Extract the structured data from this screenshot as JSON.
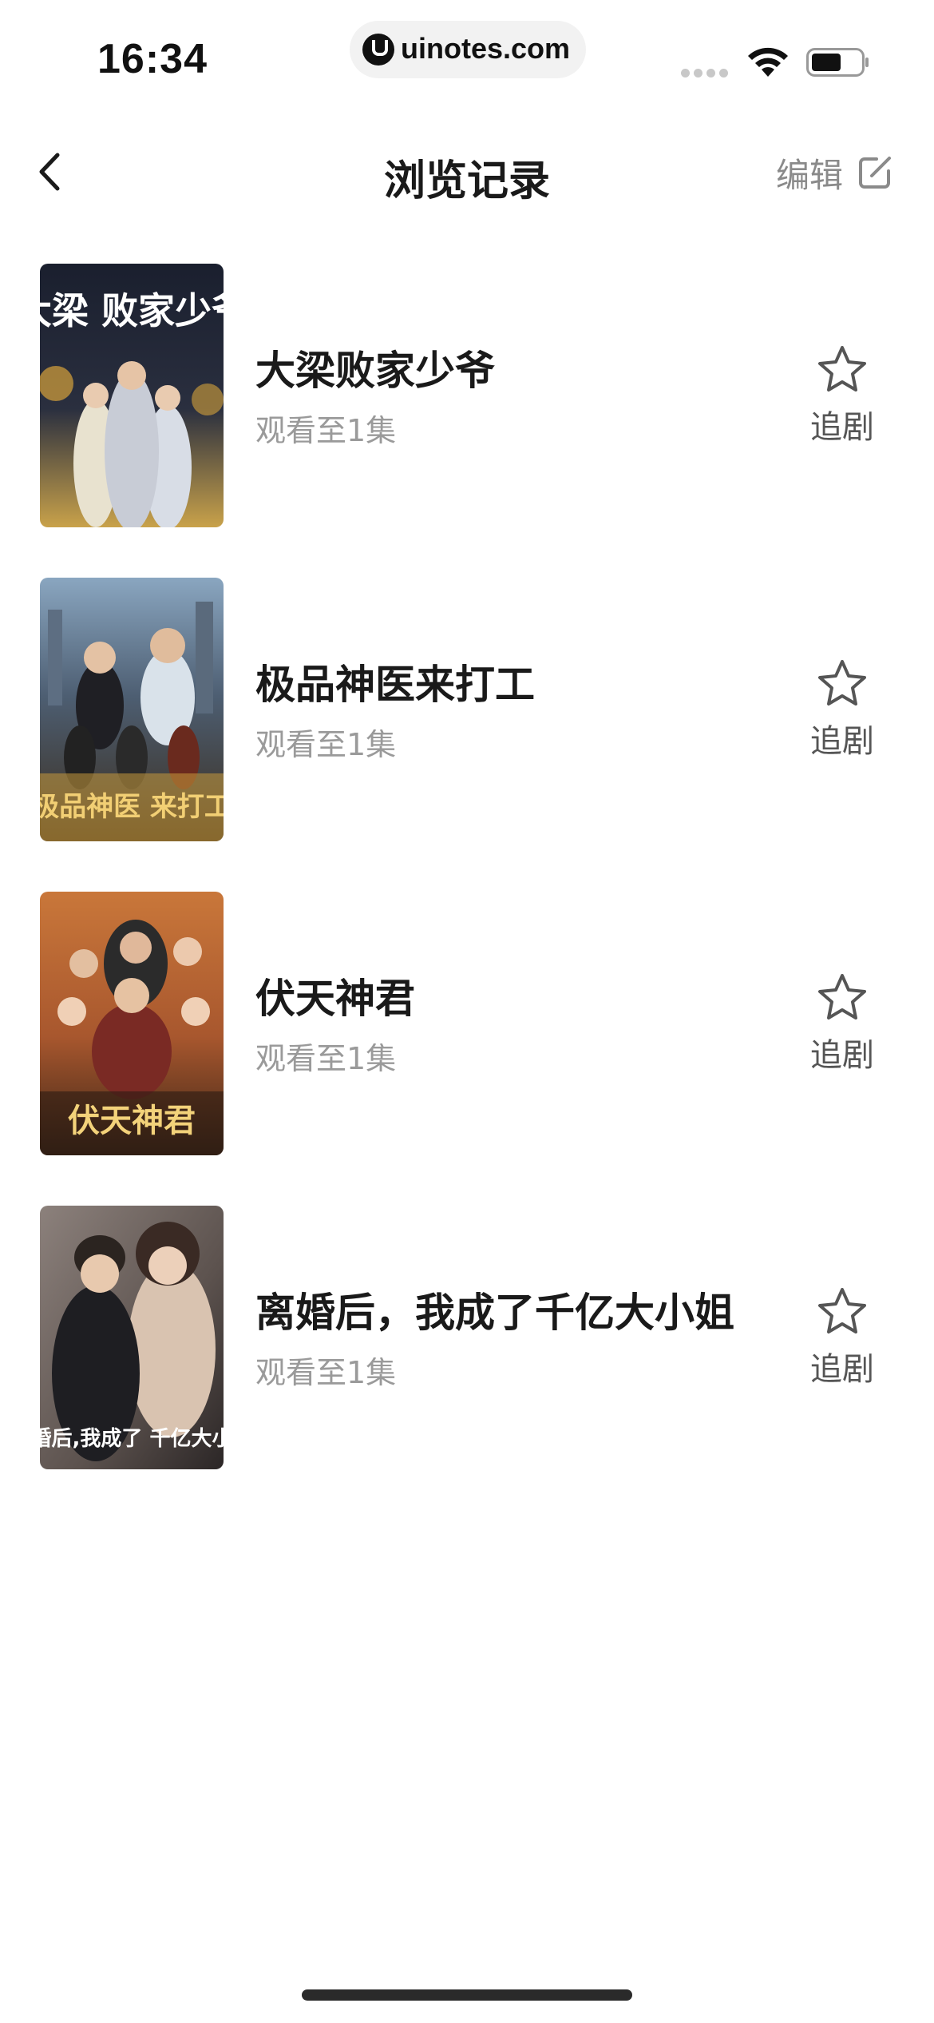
{
  "status_bar": {
    "time": "16:34",
    "url": "uinotes.com"
  },
  "nav": {
    "title": "浏览记录",
    "edit_label": "编辑"
  },
  "history": [
    {
      "title": "大梁败家少爷",
      "progress": "观看至1集",
      "follow_label": "追剧",
      "poster_caption": "大梁 败家少爷",
      "poster_colors": [
        "#1d2233",
        "#b8953f"
      ]
    },
    {
      "title": "极品神医来打工",
      "progress": "观看至1集",
      "follow_label": "追剧",
      "poster_caption": "极品神医 来打工",
      "poster_colors": [
        "#5f7a96",
        "#c99a3c"
      ]
    },
    {
      "title": "伏天神君",
      "progress": "观看至1集",
      "follow_label": "追剧",
      "poster_caption": "伏天神君",
      "poster_colors": [
        "#b86a33",
        "#e0b043"
      ]
    },
    {
      "title": "离婚后，我成了千亿大小姐",
      "progress": "观看至1集",
      "follow_label": "追剧",
      "poster_caption": "离婚后,我成了 千亿大小姐",
      "poster_colors": [
        "#7c6e68",
        "#2a2626"
      ]
    }
  ],
  "colors": {
    "title_text": "#1a1a1a",
    "secondary_text": "#9a9a9a",
    "edit_text": "#8a8a8a",
    "star_outline": "#555555"
  }
}
